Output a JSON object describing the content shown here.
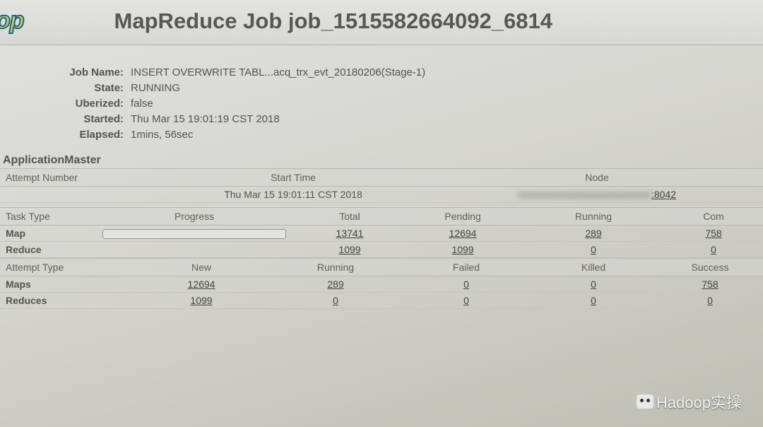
{
  "header": {
    "logo_fragment": "op",
    "title": "MapReduce Job job_1515582664092_6814"
  },
  "info": {
    "job_name_label": "Job Name:",
    "job_name": "INSERT OVERWRITE TABL...acq_trx_evt_20180206(Stage-1)",
    "state_label": "State:",
    "state": "RUNNING",
    "uberized_label": "Uberized:",
    "uberized": "false",
    "started_label": "Started:",
    "started": "Thu Mar 15 19:01:19 CST 2018",
    "elapsed_label": "Elapsed:",
    "elapsed": "1mins, 56sec"
  },
  "app_master": {
    "heading": "ApplicationMaster",
    "cols": {
      "attempt": "Attempt Number",
      "start": "Start Time",
      "node": "Node"
    },
    "row": {
      "attempt": "",
      "start": "Thu Mar 15 19:01:11 CST 2018",
      "node_hidden": "xxxxxxxxxxxxxxxxxxxxxxxxxxx",
      "node_port": ":8042"
    }
  },
  "task_table": {
    "cols": {
      "type": "Task Type",
      "progress": "Progress",
      "total": "Total",
      "pending": "Pending",
      "running": "Running",
      "complete": "Com"
    },
    "map": {
      "label": "Map",
      "total": "13741",
      "pending": "12694",
      "running": "289",
      "complete": "758",
      "progress_pct": 5
    },
    "reduce": {
      "label": "Reduce",
      "total": "1099",
      "pending": "1099",
      "running": "0",
      "complete": "0"
    }
  },
  "attempt_table": {
    "cols": {
      "type": "Attempt Type",
      "new": "New",
      "running": "Running",
      "failed": "Failed",
      "killed": "Killed",
      "success": "Success"
    },
    "maps": {
      "label": "Maps",
      "new": "12694",
      "running": "289",
      "failed": "0",
      "killed": "0",
      "success": "758"
    },
    "reduces": {
      "label": "Reduces",
      "new": "1099",
      "running": "0",
      "failed": "0",
      "killed": "0",
      "success": "0"
    }
  },
  "watermark": "Hadoop实操"
}
